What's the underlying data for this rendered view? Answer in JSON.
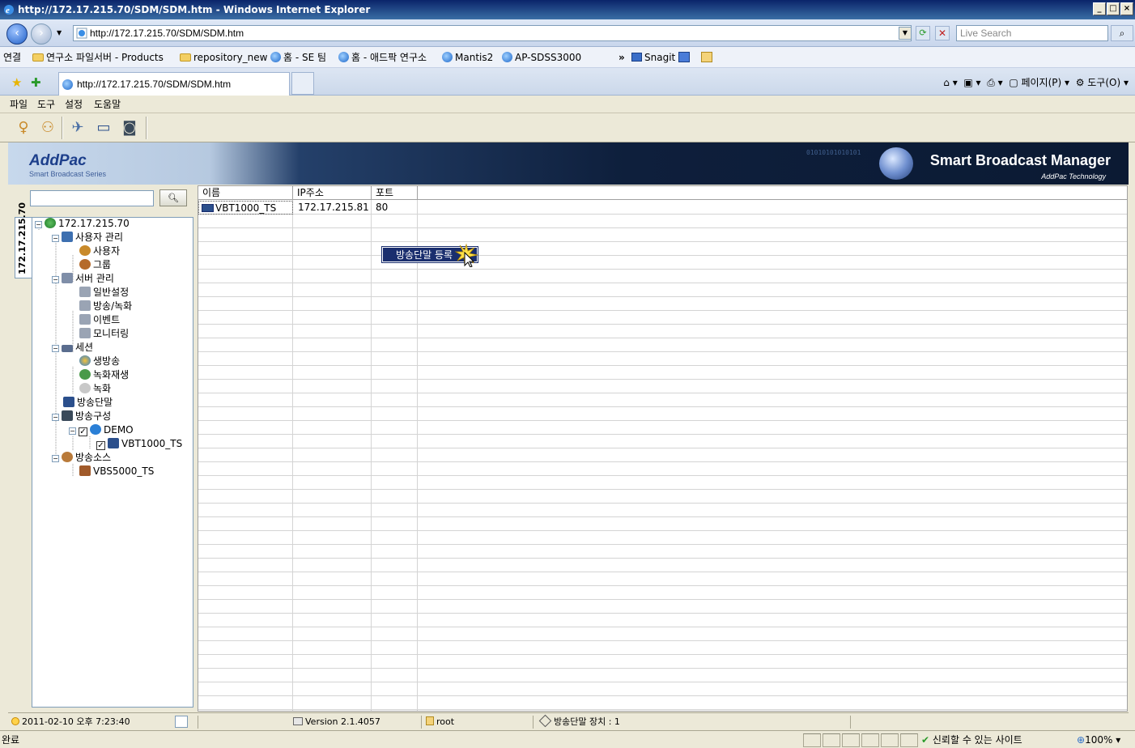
{
  "window": {
    "title": "http://172.17.215.70/SDM/SDM.htm - Windows Internet Explorer"
  },
  "browser": {
    "address": "http://172.17.215.70/SDM/SDM.htm",
    "search_placeholder": "Live Search",
    "tab_title": "http://172.17.215.70/SDM/SDM.htm",
    "links_label": "연결",
    "links": [
      "연구소 파일서버 - Products",
      "repository_new",
      "홈 - SE 팀",
      "홈 - 애드팍 연구소",
      "Mantis2",
      "AP-SDSS3000",
      "Snagit"
    ],
    "chevron": "»",
    "cmd_page": "페이지(P)",
    "cmd_tools": "도구(O)",
    "status_done": "완료",
    "trusted_site": "신뢰할 수 있는 사이트",
    "zoom": "100%"
  },
  "menu": [
    "파일",
    "도구",
    "설정",
    "도움말"
  ],
  "banner": {
    "logo": "AddPac",
    "logo_sub": "Smart Broadcast Series",
    "product": "Smart Broadcast Manager",
    "vendor": "AddPac Technology",
    "binary": "01010101010101"
  },
  "sidebar": {
    "tab_label": "172.17.215.70",
    "search_icon": "search-icon",
    "tree": {
      "root": "172.17.215.70",
      "user_mgmt": "사용자 관리",
      "user": "사용자",
      "group": "그룹",
      "server_mgmt": "서버 관리",
      "general": "일반설정",
      "broadcast_rec": "방송/녹화",
      "event": "이벤트",
      "monitoring": "모니터링",
      "session": "세션",
      "live": "생방송",
      "rec_play": "녹화재생",
      "rec": "녹화",
      "terminal": "방송단말",
      "config": "방송구성",
      "demo": "DEMO",
      "vbt": "VBT1000_TS",
      "source": "방송소스",
      "vbs": "VBS5000_TS"
    }
  },
  "table": {
    "headers": [
      "이름",
      "IP주소",
      "포트"
    ],
    "rows": [
      {
        "name": "VBT1000_TS",
        "ip": "172.17.215.81",
        "port": "80"
      }
    ]
  },
  "context_menu": {
    "item": "방송단말 등록"
  },
  "status": {
    "datetime": "2011-02-10 오후 7:23:40",
    "version": "Version 2.1.4057",
    "user": "root",
    "device_count": "방송단말 장치 : 1"
  }
}
